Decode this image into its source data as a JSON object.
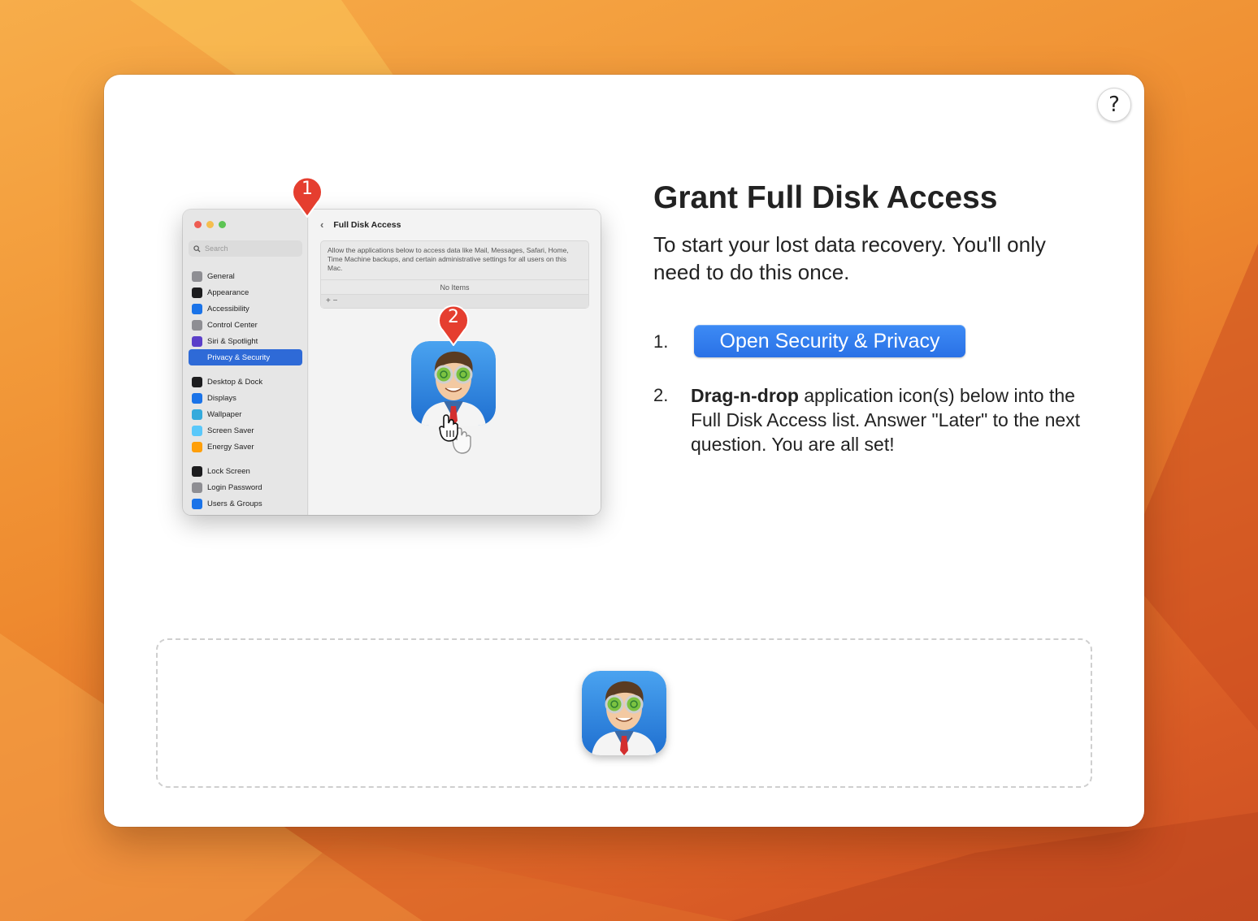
{
  "dialog": {
    "help_label": "?",
    "title": "Grant Full Disk Access",
    "subtitle": "To start your lost data recovery. You'll only need to do this once.",
    "step1_number": "1.",
    "open_button_label": "Open Security & Privacy",
    "step2_number": "2.",
    "step2_bold": "Drag-n-drop",
    "step2_text": " application icon(s) below into the Full Disk Access list. Answer \"Later\" to the next question. You are all set!"
  },
  "illustration": {
    "pin1": "1",
    "pin2": "2",
    "search_placeholder": "Search",
    "panel_title": "Full Disk Access",
    "panel_description": "Allow the applications below to access data like Mail, Messages, Safari, Home, Time Machine backups, and certain administrative settings for all users on this Mac.",
    "no_items": "No Items",
    "plus_minus": "+  −",
    "sidebar_items": [
      {
        "label": "General",
        "color": "#8e8e93"
      },
      {
        "label": "Appearance",
        "color": "#1c1c1e"
      },
      {
        "label": "Accessibility",
        "color": "#1a73e8"
      },
      {
        "label": "Control Center",
        "color": "#8e8e93"
      },
      {
        "label": "Siri & Spotlight",
        "color": "#5b3fc9"
      },
      {
        "label": "Privacy & Security",
        "color": "#2e6ad7"
      },
      {
        "label": "Desktop & Dock",
        "color": "#1c1c1e"
      },
      {
        "label": "Displays",
        "color": "#1a73e8"
      },
      {
        "label": "Wallpaper",
        "color": "#34aadc"
      },
      {
        "label": "Screen Saver",
        "color": "#5ac8fa"
      },
      {
        "label": "Energy Saver",
        "color": "#ff9f0a"
      },
      {
        "label": "Lock Screen",
        "color": "#1c1c1e"
      },
      {
        "label": "Login Password",
        "color": "#8e8e93"
      },
      {
        "label": "Users & Groups",
        "color": "#1a73e8"
      }
    ]
  },
  "colors": {
    "accent": "#2f7cf0",
    "pin": "#e53e2f",
    "selected_sidebar": "#2e6ad7"
  }
}
